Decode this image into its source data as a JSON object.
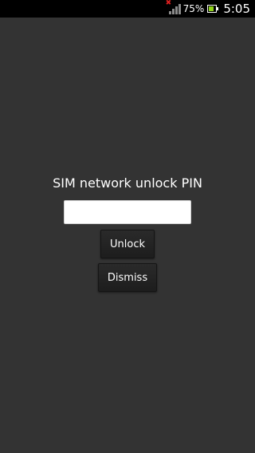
{
  "status_bar": {
    "signal_icon": "signal-no-sim-icon",
    "battery_percent": "75%",
    "battery_level": 0.75,
    "battery_icon": "battery-icon",
    "time": "5:05",
    "colors": {
      "background": "#000000",
      "battery_fill": "#8fd11a",
      "signal_error": "#e02020"
    }
  },
  "unlock_dialog": {
    "title": "SIM network unlock PIN",
    "pin_value": "",
    "unlock_label": "Unlock",
    "dismiss_label": "Dismiss"
  }
}
